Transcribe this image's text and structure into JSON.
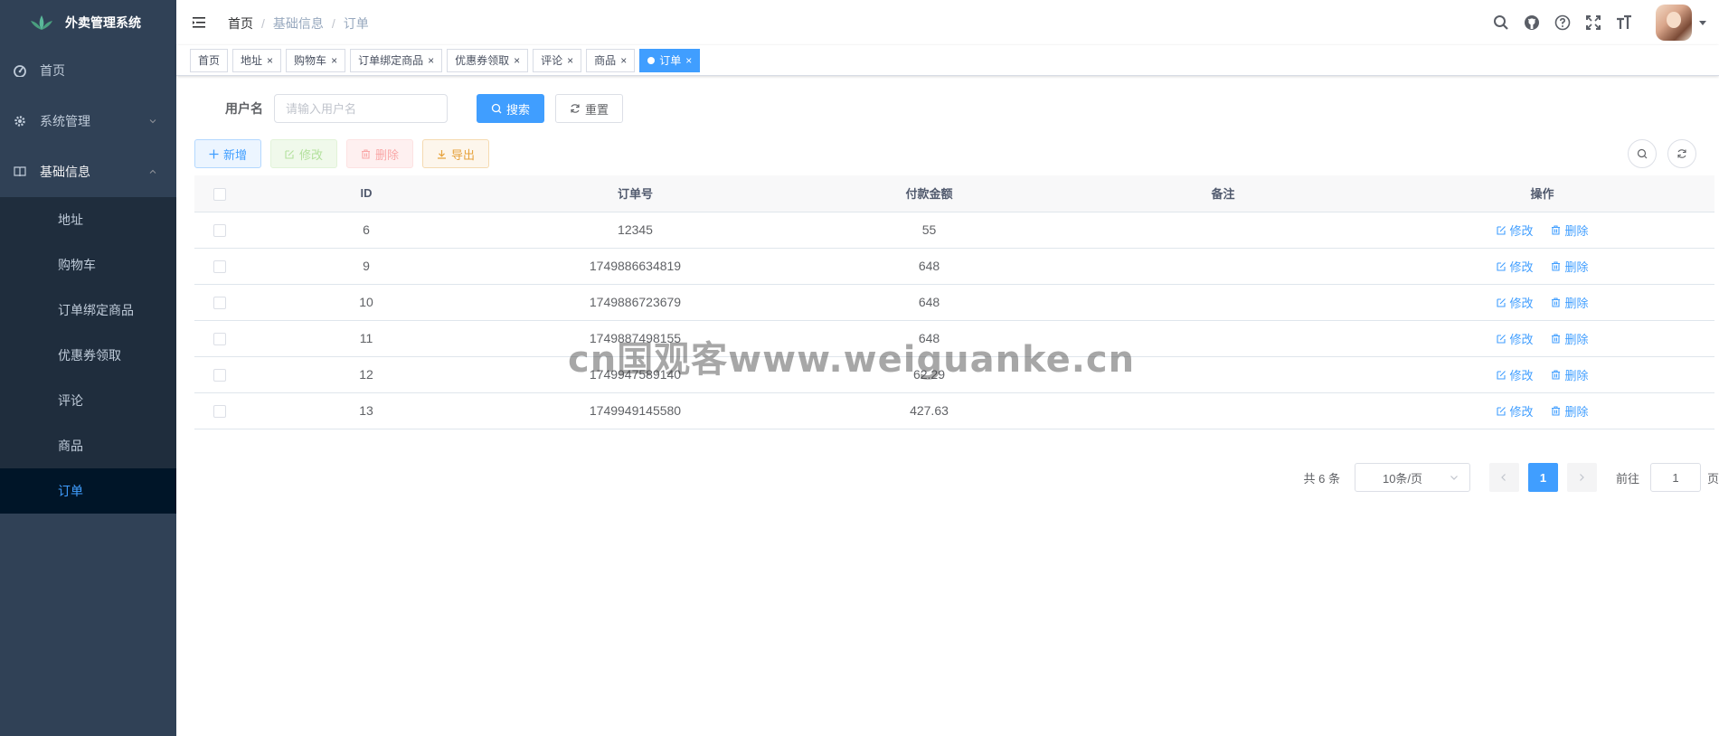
{
  "app": {
    "title": "外卖管理系统"
  },
  "sidebar": {
    "items": [
      {
        "label": "首页",
        "icon": "dashboard-icon"
      },
      {
        "label": "系统管理",
        "icon": "gear-icon"
      },
      {
        "label": "基础信息",
        "icon": "book-icon"
      }
    ],
    "subitems": [
      "地址",
      "购物车",
      "订单绑定商品",
      "优惠券领取",
      "评论",
      "商品",
      "订单"
    ],
    "active_subitem": "订单"
  },
  "breadcrumb": [
    "首页",
    "基础信息",
    "订单"
  ],
  "tags": [
    {
      "label": "首页",
      "closable": false
    },
    {
      "label": "地址",
      "closable": true
    },
    {
      "label": "购物车",
      "closable": true
    },
    {
      "label": "订单绑定商品",
      "closable": true
    },
    {
      "label": "优惠券领取",
      "closable": true
    },
    {
      "label": "评论",
      "closable": true
    },
    {
      "label": "商品",
      "closable": true
    },
    {
      "label": "订单",
      "closable": true,
      "active": true
    }
  ],
  "tag_close": "×",
  "search": {
    "label": "用户名",
    "placeholder": "请输入用户名",
    "search_btn": "搜索",
    "reset_btn": "重置"
  },
  "toolbar": {
    "add": "新增",
    "edit": "修改",
    "delete": "删除",
    "export": "导出"
  },
  "table": {
    "headers": [
      "ID",
      "订单号",
      "付款金额",
      "备注",
      "操作"
    ],
    "rows": [
      {
        "id": "6",
        "order_no": "12345",
        "amount": "55",
        "remark": ""
      },
      {
        "id": "9",
        "order_no": "1749886634819",
        "amount": "648",
        "remark": ""
      },
      {
        "id": "10",
        "order_no": "1749886723679",
        "amount": "648",
        "remark": ""
      },
      {
        "id": "11",
        "order_no": "1749887498155",
        "amount": "648",
        "remark": ""
      },
      {
        "id": "12",
        "order_no": "1749947589140",
        "amount": "62.29",
        "remark": ""
      },
      {
        "id": "13",
        "order_no": "1749949145580",
        "amount": "427.63",
        "remark": ""
      }
    ],
    "row_edit": "修改",
    "row_delete": "删除"
  },
  "pagination": {
    "total": "共 6 条",
    "page_size": "10条/页",
    "current_page": "1",
    "goto_label": "前往",
    "goto_value": "1",
    "goto_suffix": "页"
  },
  "watermark": "cn国观客www.weiguanke.cn",
  "colors": {
    "sidebar_bg": "#304156",
    "primary": "#409eff",
    "active_menu_text": "#409eff"
  }
}
